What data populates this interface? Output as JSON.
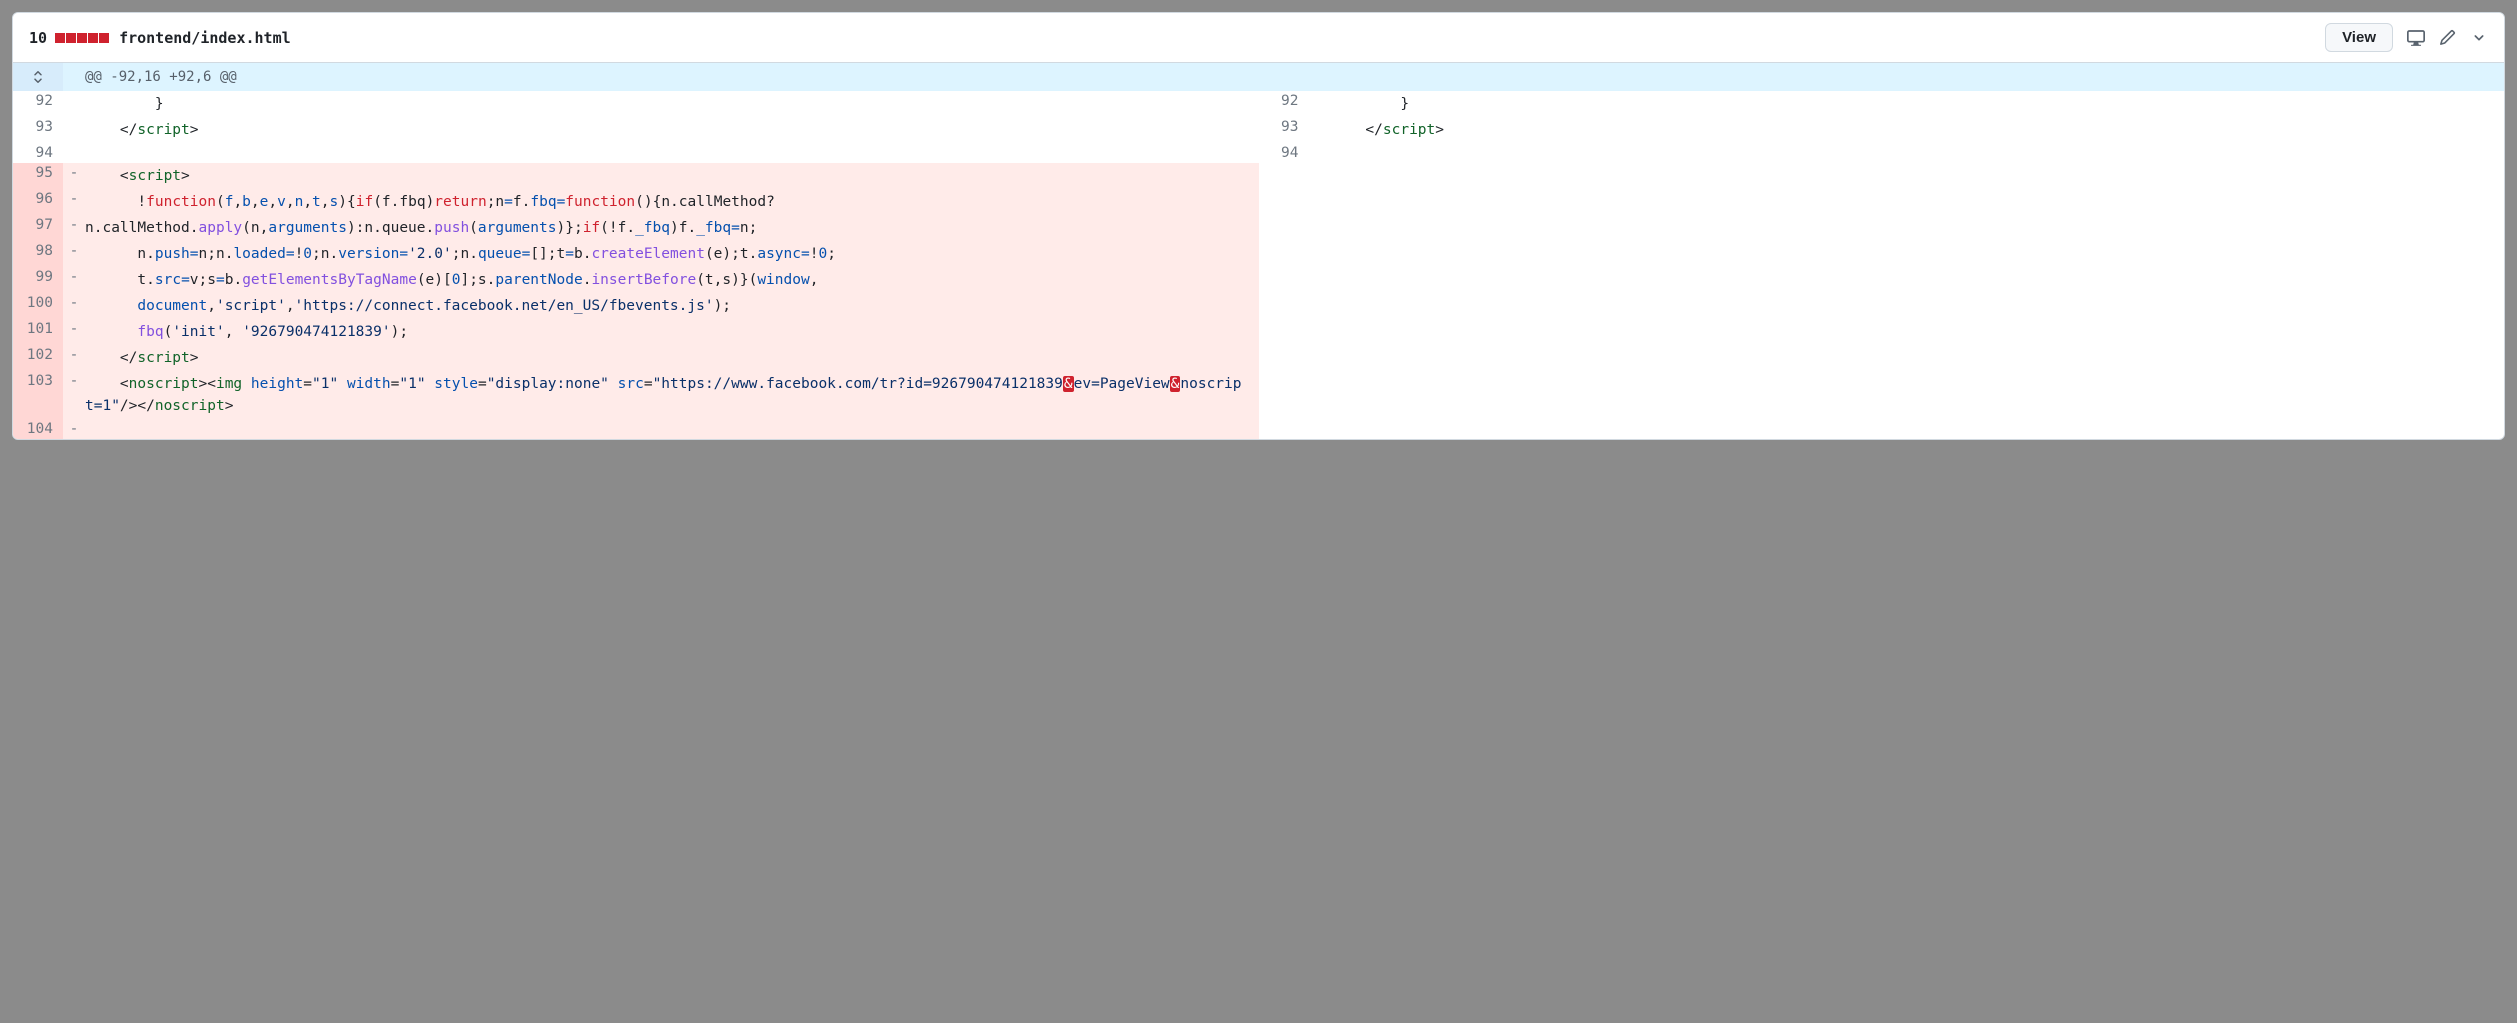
{
  "header": {
    "diff_count": "10",
    "file_path": "frontend/index.html",
    "view_label": "View"
  },
  "hunk": {
    "text": "@@ -92,16 +92,6 @@"
  },
  "left": {
    "rows": [
      {
        "n": "92",
        "mark": "",
        "type": "ctx",
        "html": "        }"
      },
      {
        "n": "93",
        "mark": "",
        "type": "ctx",
        "html": "    &lt;/<span class='tok-tag'>script</span>&gt;"
      },
      {
        "n": "94",
        "mark": "",
        "type": "ctx",
        "html": ""
      },
      {
        "n": "95",
        "mark": "-",
        "type": "del",
        "html": "    &lt;<span class='tok-tag'>script</span>&gt;"
      },
      {
        "n": "96",
        "mark": "-",
        "type": "del",
        "html": "      !<span class='tok-kw'>function</span>(<span class='tok-attr'>f</span>,<span class='tok-attr'>b</span>,<span class='tok-attr'>e</span>,<span class='tok-attr'>v</span>,<span class='tok-attr'>n</span>,<span class='tok-attr'>t</span>,<span class='tok-attr'>s</span>){<span class='tok-kw'>if</span>(f.fbq)<span class='tok-kw'>return</span>;n<span class='tok-op'>=</span>f.<span class='tok-attr'>fbq</span><span class='tok-op'>=</span><span class='tok-kw'>function</span>(){n.callMethod?"
      },
      {
        "n": "97",
        "mark": "-",
        "type": "del",
        "html": "n.callMethod.<span class='tok-fn'>apply</span>(n,<span class='tok-attr'>arguments</span>):n.queue.<span class='tok-fn'>push</span>(<span class='tok-attr'>arguments</span>)};<span class='tok-kw'>if</span>(!f.<span class='tok-attr'>_fbq</span>)f.<span class='tok-attr'>_fbq</span><span class='tok-op'>=</span>n;"
      },
      {
        "n": "98",
        "mark": "-",
        "type": "del",
        "html": "      n.<span class='tok-attr'>push</span><span class='tok-op'>=</span>n;n.<span class='tok-attr'>loaded</span><span class='tok-op'>=</span>!<span class='tok-num'>0</span>;n.<span class='tok-attr'>version</span><span class='tok-op'>=</span><span class='tok-str'>'2.0'</span>;n.<span class='tok-attr'>queue</span><span class='tok-op'>=</span>[];t<span class='tok-op'>=</span>b.<span class='tok-fn'>createElement</span>(e);t.<span class='tok-attr'>async</span><span class='tok-op'>=</span>!<span class='tok-num'>0</span>;"
      },
      {
        "n": "99",
        "mark": "-",
        "type": "del",
        "html": "      t.<span class='tok-attr'>src</span><span class='tok-op'>=</span>v;s<span class='tok-op'>=</span>b.<span class='tok-fn'>getElementsByTagName</span>(e)[<span class='tok-num'>0</span>];s.<span class='tok-attr'>parentNode</span>.<span class='tok-fn'>insertBefore</span>(t,s)}(<span class='tok-attr'>window</span>,"
      },
      {
        "n": "100",
        "mark": "-",
        "type": "del",
        "html": "      <span class='tok-attr'>document</span>,<span class='tok-str'>'script'</span>,<span class='tok-str'>'https://connect.facebook.net/en_US/fbevents.js'</span>);"
      },
      {
        "n": "101",
        "mark": "-",
        "type": "del",
        "html": "      <span class='tok-fn'>fbq</span>(<span class='tok-str'>'init'</span>, <span class='tok-str'>'926790474121839'</span>);"
      },
      {
        "n": "102",
        "mark": "-",
        "type": "del",
        "html": "    &lt;/<span class='tok-tag'>script</span>&gt;"
      },
      {
        "n": "103",
        "mark": "-",
        "type": "del",
        "html": "    &lt;<span class='tok-tag'>noscript</span>&gt;&lt;<span class='tok-tag'>img</span> <span class='tok-attr'>height</span>=<span class='tok-str'>\"1\"</span> <span class='tok-attr'>width</span>=<span class='tok-str'>\"1\"</span> <span class='tok-attr'>style</span>=<span class='tok-str'>\"display:none\"</span> <span class='tok-attr'>src</span>=<span class='tok-str'>\"https://www.facebook.com/tr?id=926790474121839</span><span class='ws-err'>&amp;</span><span class='tok-str'>ev=PageView</span><span class='ws-err'>&amp;</span><span class='tok-str'>noscript=1\"</span>/&gt;&lt;/<span class='tok-tag'>noscript</span>&gt;"
      },
      {
        "n": "104",
        "mark": "-",
        "type": "del",
        "html": ""
      }
    ]
  },
  "right": {
    "rows": [
      {
        "n": "92",
        "mark": "",
        "type": "ctx",
        "html": "        }"
      },
      {
        "n": "93",
        "mark": "",
        "type": "ctx",
        "html": "    &lt;/<span class='tok-tag'>script</span>&gt;"
      },
      {
        "n": "94",
        "mark": "",
        "type": "ctx",
        "html": ""
      },
      {
        "n": "",
        "mark": "",
        "type": "empty",
        "html": ""
      },
      {
        "n": "",
        "mark": "",
        "type": "empty",
        "html": ""
      },
      {
        "n": "",
        "mark": "",
        "type": "empty",
        "html": ""
      },
      {
        "n": "",
        "mark": "",
        "type": "empty",
        "html": ""
      },
      {
        "n": "",
        "mark": "",
        "type": "empty",
        "html": ""
      },
      {
        "n": "",
        "mark": "",
        "type": "empty",
        "html": ""
      },
      {
        "n": "",
        "mark": "",
        "type": "empty",
        "html": ""
      },
      {
        "n": "",
        "mark": "",
        "type": "empty",
        "html": ""
      },
      {
        "n": "",
        "mark": "",
        "type": "empty",
        "html": ""
      },
      {
        "n": "",
        "mark": "",
        "type": "empty",
        "html": ""
      }
    ]
  }
}
